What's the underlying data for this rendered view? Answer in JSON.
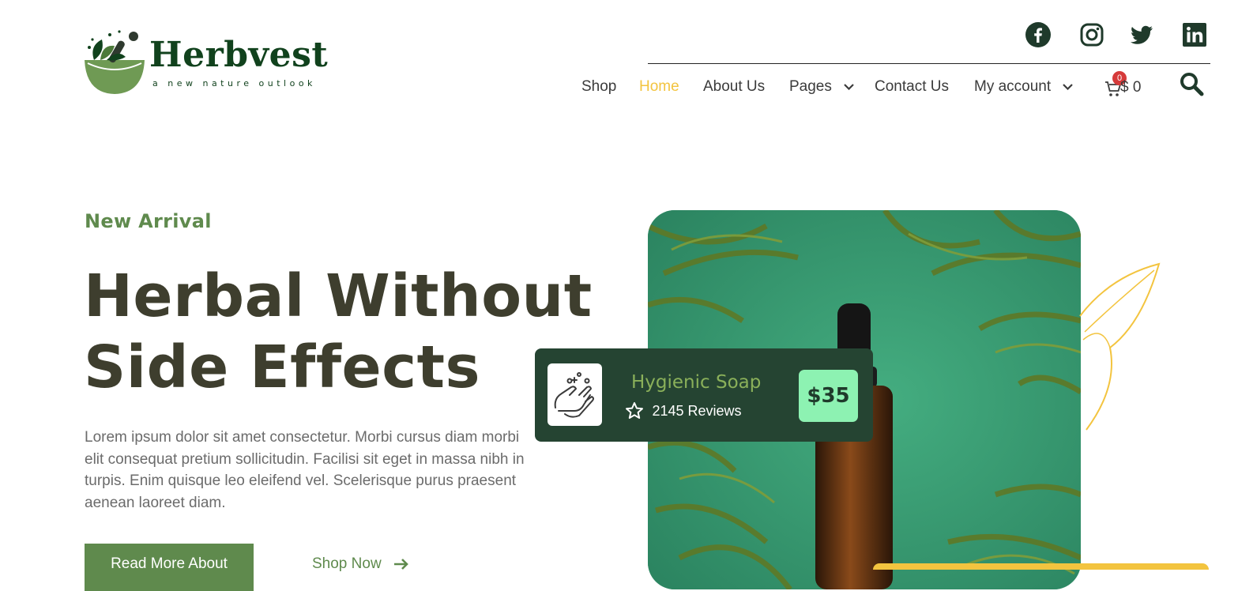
{
  "brand": {
    "name": "Herbvest",
    "tagline": "a new nature outlook"
  },
  "social": [
    {
      "icon": "facebook-icon"
    },
    {
      "icon": "instagram-icon"
    },
    {
      "icon": "twitter-icon"
    },
    {
      "icon": "linkedin-icon"
    }
  ],
  "nav": {
    "items": [
      {
        "label": "Shop"
      },
      {
        "label": "Home",
        "active": true
      },
      {
        "label": "About Us"
      },
      {
        "label": "Pages",
        "has_dropdown": true
      },
      {
        "label": "Contact Us"
      },
      {
        "label": "My account",
        "has_dropdown": true
      }
    ],
    "cart": {
      "count": "0",
      "amount": "$ 0"
    }
  },
  "hero": {
    "eyebrow": "New Arrival",
    "headline_line1": "Herbal Without",
    "headline_line2": "Side Effects",
    "body": "Lorem ipsum dolor sit amet consectetur. Morbi cursus diam morbi elit consequat pretium sollicitudin. Facilisi sit eget in massa nibh in turpis. Enim quisque leo eleifend vel. Scelerisque purus praesent aenean laoreet diam.",
    "primary_button": "Read More About",
    "secondary_link": "Shop Now"
  },
  "product_card": {
    "title": "Hygienic Soap",
    "reviews": "2145 Reviews",
    "price": "$35"
  },
  "colors": {
    "brand_green": "#11421d",
    "accent_green": "#5f8a4d",
    "nav_active": "#f3c43f",
    "card_bg": "#254432",
    "price_bg": "#8df2b2",
    "headline": "#3e3e2e"
  }
}
